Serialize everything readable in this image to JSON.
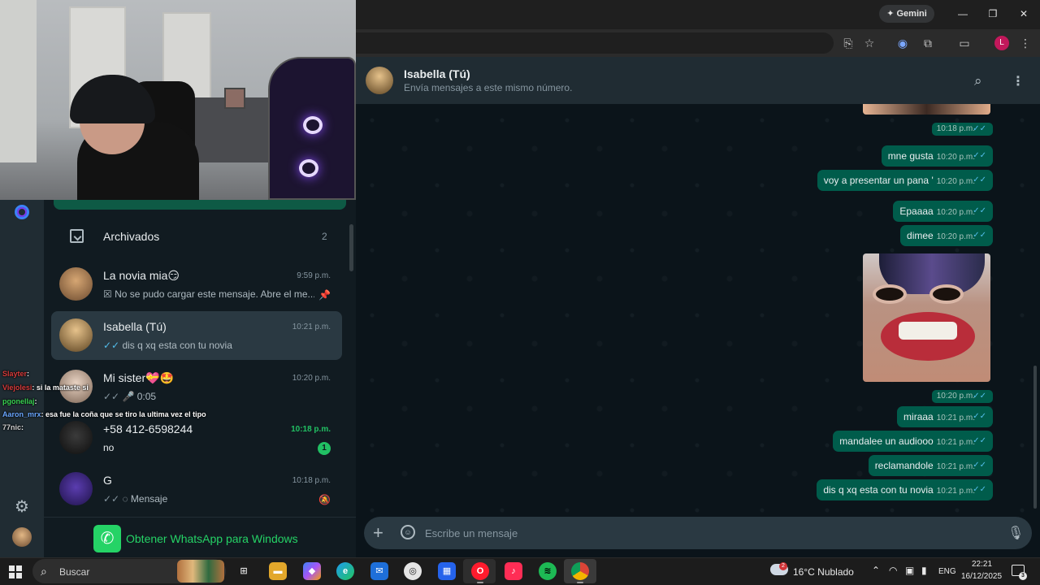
{
  "browser": {
    "gemini_label": "✦ Gemini",
    "minimize": "—",
    "maximize": "❐",
    "close": "✕",
    "profile_initial": "L"
  },
  "sidebar": {
    "archived_label": "Archivados",
    "archived_count": "2",
    "get_whatsapp": "Obtener WhatsApp para Windows"
  },
  "chats": [
    {
      "name": "La novia mia😏",
      "time": "9:59 p.m.",
      "preview": "☒ No se pudo cargar este mensaje. Abre el me...",
      "pinned": true
    },
    {
      "name": "Isabella (Tú)",
      "time": "10:21 p.m.",
      "preview_ticks": "✓✓",
      "preview": "dis q xq esta con tu novia"
    },
    {
      "name": "Mi sister💝🤩",
      "time": "10:20 p.m.",
      "preview_ticks": "✓✓",
      "preview": "🎤 0:05"
    },
    {
      "name": "+58 412-6598244",
      "time": "10:18 p.m.",
      "preview": "no",
      "unread": "1"
    },
    {
      "name": "G",
      "time": "10:18 p.m.",
      "preview_ticks": "✓✓",
      "preview": "◌ Mensaje",
      "muted": true
    }
  ],
  "twitch_chat": [
    {
      "user": "Slayter",
      "text": ":",
      "color": "#d63b3b"
    },
    {
      "user": "Viejolesi",
      "text": ": si la mataste si",
      "color": "#d63b3b"
    },
    {
      "user": "pgonellaj",
      "text": ":",
      "color": "#39d353"
    },
    {
      "user": "Aaron_mrx",
      "text": ": esa fue la coña que se tiro la ultima vez el tipo",
      "color": "#6aa7ff"
    },
    {
      "user": "77nic",
      "text": ":",
      "color": "#cfcfcf"
    }
  ],
  "conversation": {
    "name": "Isabella (Tú)",
    "subtitle": "Envía mensajes a este mismo número.",
    "input_placeholder": "Escribe un mensaje",
    "messages": [
      {
        "text": "",
        "time": "10:18 p.m."
      },
      {
        "text": "mne gusta",
        "time": "10:20 p.m."
      },
      {
        "text": "voy a presentar un pana '",
        "time": "10:20 p.m."
      },
      {
        "text": "Epaaaa",
        "time": "10:20 p.m."
      },
      {
        "text": "dimee",
        "time": "10:20 p.m."
      },
      {
        "text": "",
        "time": "10:20 p.m."
      },
      {
        "text": "miraaa",
        "time": "10:21 p.m."
      },
      {
        "text": "mandalee un audiooo",
        "time": "10:21 p.m."
      },
      {
        "text": "reclamandole",
        "time": "10:21 p.m."
      },
      {
        "text": "dis q xq esta con tu novia",
        "time": "10:21 p.m."
      }
    ],
    "ticks": "✓✓"
  },
  "taskbar": {
    "search_label": "Buscar",
    "weather": "16°C  Nublado",
    "weather_badge": "2",
    "language": "ENG",
    "time": "22:21",
    "date": "16/12/2025",
    "notifications": "3"
  },
  "icons": {
    "settings": "⚙",
    "search": "🔍",
    "menu": "⋮",
    "plus": "+",
    "mic": "🎙",
    "pin": "📌",
    "mute": "🔕"
  }
}
